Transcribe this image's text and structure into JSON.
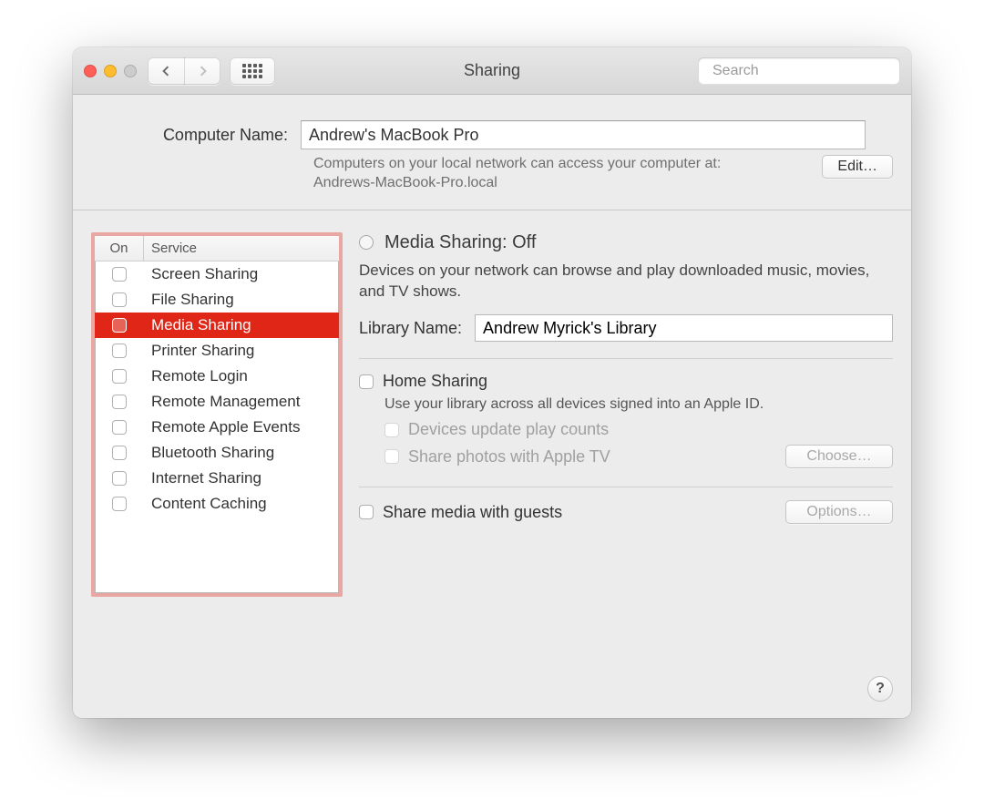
{
  "window": {
    "title": "Sharing"
  },
  "search": {
    "placeholder": "Search"
  },
  "computerName": {
    "label": "Computer Name:",
    "value": "Andrew's MacBook Pro",
    "hint_line1": "Computers on your local network can access your computer at:",
    "hint_line2": "Andrews-MacBook-Pro.local",
    "edit_label": "Edit…"
  },
  "servicesHeader": {
    "on": "On",
    "service": "Service"
  },
  "services": [
    {
      "label": "Screen Sharing",
      "on": false,
      "selected": false
    },
    {
      "label": "File Sharing",
      "on": false,
      "selected": false
    },
    {
      "label": "Media Sharing",
      "on": false,
      "selected": true
    },
    {
      "label": "Printer Sharing",
      "on": false,
      "selected": false
    },
    {
      "label": "Remote Login",
      "on": false,
      "selected": false
    },
    {
      "label": "Remote Management",
      "on": false,
      "selected": false
    },
    {
      "label": "Remote Apple Events",
      "on": false,
      "selected": false
    },
    {
      "label": "Bluetooth Sharing",
      "on": false,
      "selected": false
    },
    {
      "label": "Internet Sharing",
      "on": false,
      "selected": false
    },
    {
      "label": "Content Caching",
      "on": false,
      "selected": false
    }
  ],
  "detail": {
    "status_title": "Media Sharing: Off",
    "description": "Devices on your network can browse and play downloaded music, movies, and TV shows.",
    "library_label": "Library Name:",
    "library_value": "Andrew Myrick's Library",
    "home_sharing_label": "Home Sharing",
    "home_sharing_desc": "Use your library across all devices signed into an Apple ID.",
    "opt_play_counts": "Devices update play counts",
    "opt_share_photos": "Share photos with Apple TV",
    "choose_label": "Choose…",
    "share_guests_label": "Share media with guests",
    "options_label": "Options…"
  },
  "help_label": "?"
}
